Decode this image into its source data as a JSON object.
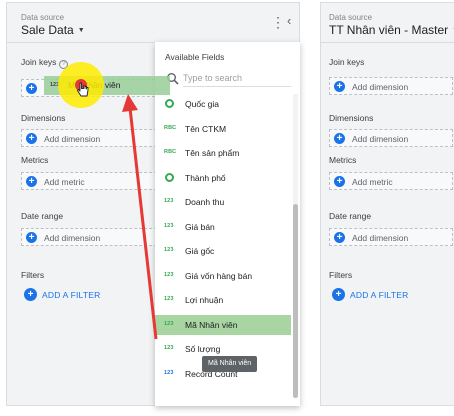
{
  "left": {
    "caption": "Data source",
    "name": "Sale Data",
    "join_keys_label": "Join keys",
    "dimensions_label": "Dimensions",
    "add_dimension": "Add dimension",
    "metrics_label": "Metrics",
    "add_metric": "Add metric",
    "date_range_label": "Date range",
    "filters_label": "Filters",
    "add_filter": "ADD A FILTER"
  },
  "drag": {
    "type": "123",
    "name": "Mã Nhân viên"
  },
  "right": {
    "caption": "Data source",
    "name": "TT Nhân viên - Master",
    "join_keys_label": "Join keys",
    "add_dimension": "Add dimension",
    "dimensions_label": "Dimensions",
    "metrics_label": "Metrics",
    "add_metric": "Add metric",
    "date_range_label": "Date range",
    "filters_label": "Filters",
    "add_filter": "ADD A FILTER"
  },
  "dropdown": {
    "title": "Available Fields",
    "search_placeholder": "Type to search",
    "items": [
      {
        "type": "globe",
        "type_label": "",
        "name": "Quốc gia"
      },
      {
        "type": "abc",
        "type_label": "RBC",
        "name": "Tên CTKM"
      },
      {
        "type": "abc",
        "type_label": "RBC",
        "name": "Tên sản phẩm"
      },
      {
        "type": "globe",
        "type_label": "",
        "name": "Thành phố"
      },
      {
        "type": "num",
        "type_label": "123",
        "name": "Doanh thu"
      },
      {
        "type": "num",
        "type_label": "123",
        "name": "Giá bán"
      },
      {
        "type": "num",
        "type_label": "123",
        "name": "Giá gốc"
      },
      {
        "type": "num",
        "type_label": "123",
        "name": "Giá vốn hàng bán"
      },
      {
        "type": "num",
        "type_label": "123",
        "name": "Lợi nhuận"
      },
      {
        "type": "num",
        "type_label": "123",
        "name": "Mã Nhân viên"
      },
      {
        "type": "num",
        "type_label": "123",
        "name": "Số lượng"
      },
      {
        "type": "rc",
        "type_label": "123",
        "name": "Record Count"
      }
    ],
    "selected_index": 9,
    "tooltip": "Mã Nhân viên"
  },
  "colors": {
    "accent": "#1a73e8",
    "drag_highlight": "#98ce98",
    "arrow": "#e53935",
    "cursor_glow": "#ffeb00"
  }
}
